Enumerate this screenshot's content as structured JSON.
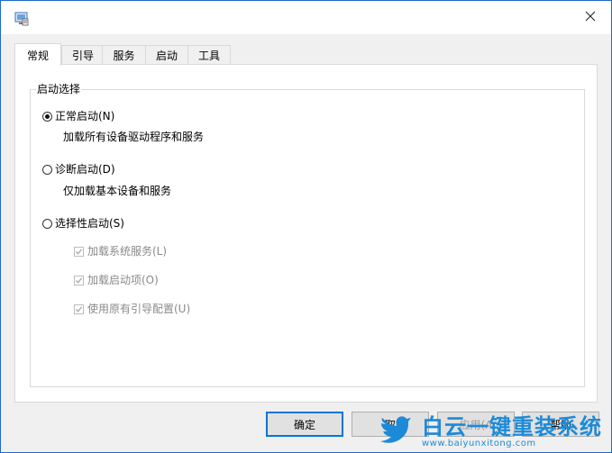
{
  "tabs": [
    {
      "label": "常规",
      "active": true
    },
    {
      "label": "引导",
      "active": false
    },
    {
      "label": "服务",
      "active": false
    },
    {
      "label": "启动",
      "active": false
    },
    {
      "label": "工具",
      "active": false
    }
  ],
  "group": {
    "title": "启动选择"
  },
  "options": {
    "normal": {
      "label": "正常启动(N)",
      "desc": "加载所有设备驱动程序和服务",
      "selected": true
    },
    "diagnostic": {
      "label": "诊断启动(D)",
      "desc": "仅加载基本设备和服务",
      "selected": false
    },
    "selective": {
      "label": "选择性启动(S)",
      "selected": false
    }
  },
  "checkboxes": [
    {
      "label": "加载系统服务(L)",
      "checked": true,
      "enabled": false
    },
    {
      "label": "加载启动项(O)",
      "checked": true,
      "enabled": false
    },
    {
      "label": "使用原有引导配置(U)",
      "checked": true,
      "enabled": false
    }
  ],
  "buttons": {
    "ok": "确定",
    "cancel": "取",
    "apply": "应用(A",
    "help": "帮助"
  },
  "watermark": {
    "title": "白云一键重装系统",
    "url": "www.baiyunxitong.com"
  },
  "colors": {
    "accent": "#0078d7",
    "window_border": "#1c6bc9",
    "watermark": "#1d8ad7"
  }
}
